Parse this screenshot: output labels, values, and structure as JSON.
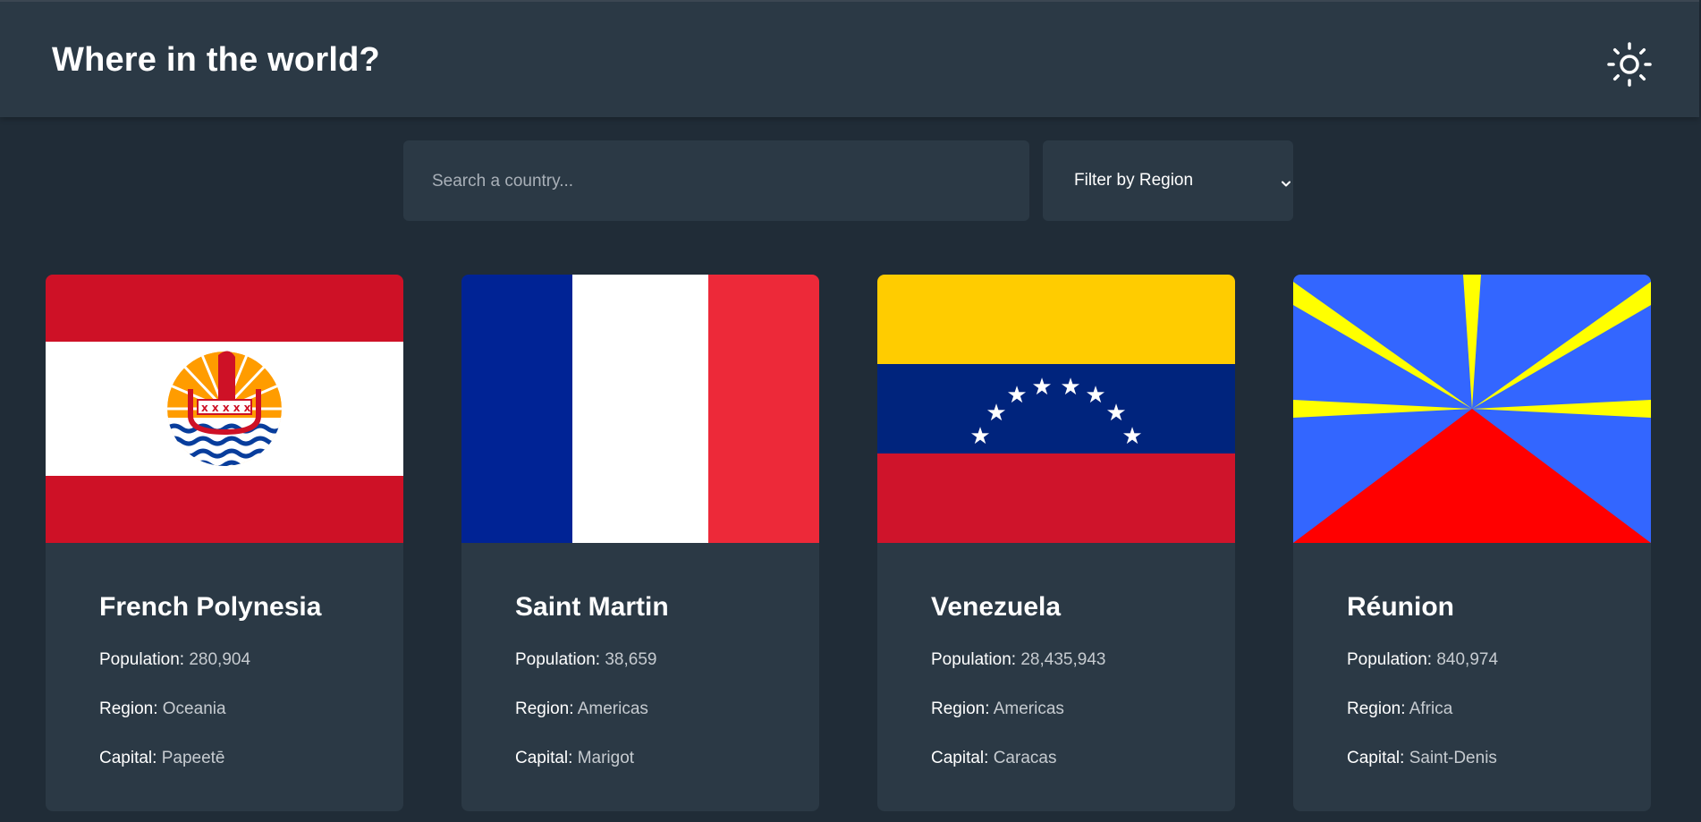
{
  "header": {
    "title": "Where in the world?",
    "theme_toggle_icon": "sun-icon"
  },
  "search": {
    "placeholder": "Search a country..."
  },
  "filter": {
    "label": "Filter by Region",
    "icon": "chevron-down-icon"
  },
  "labels": {
    "population": "Population:",
    "region": "Region:",
    "capital": "Capital:"
  },
  "countries": [
    {
      "name": "French Polynesia",
      "population": "280,904",
      "region": "Oceania",
      "capital": "Papeetē"
    },
    {
      "name": "Saint Martin",
      "population": "38,659",
      "region": "Americas",
      "capital": "Marigot"
    },
    {
      "name": "Venezuela",
      "population": "28,435,943",
      "region": "Americas",
      "capital": "Caracas"
    },
    {
      "name": "Réunion",
      "population": "840,974",
      "region": "Africa",
      "capital": "Saint-Denis"
    }
  ],
  "colors": {
    "background": "#202c37",
    "elements": "#2b3945",
    "text": "#ffffff",
    "muted_text": "#c6cbd0"
  }
}
